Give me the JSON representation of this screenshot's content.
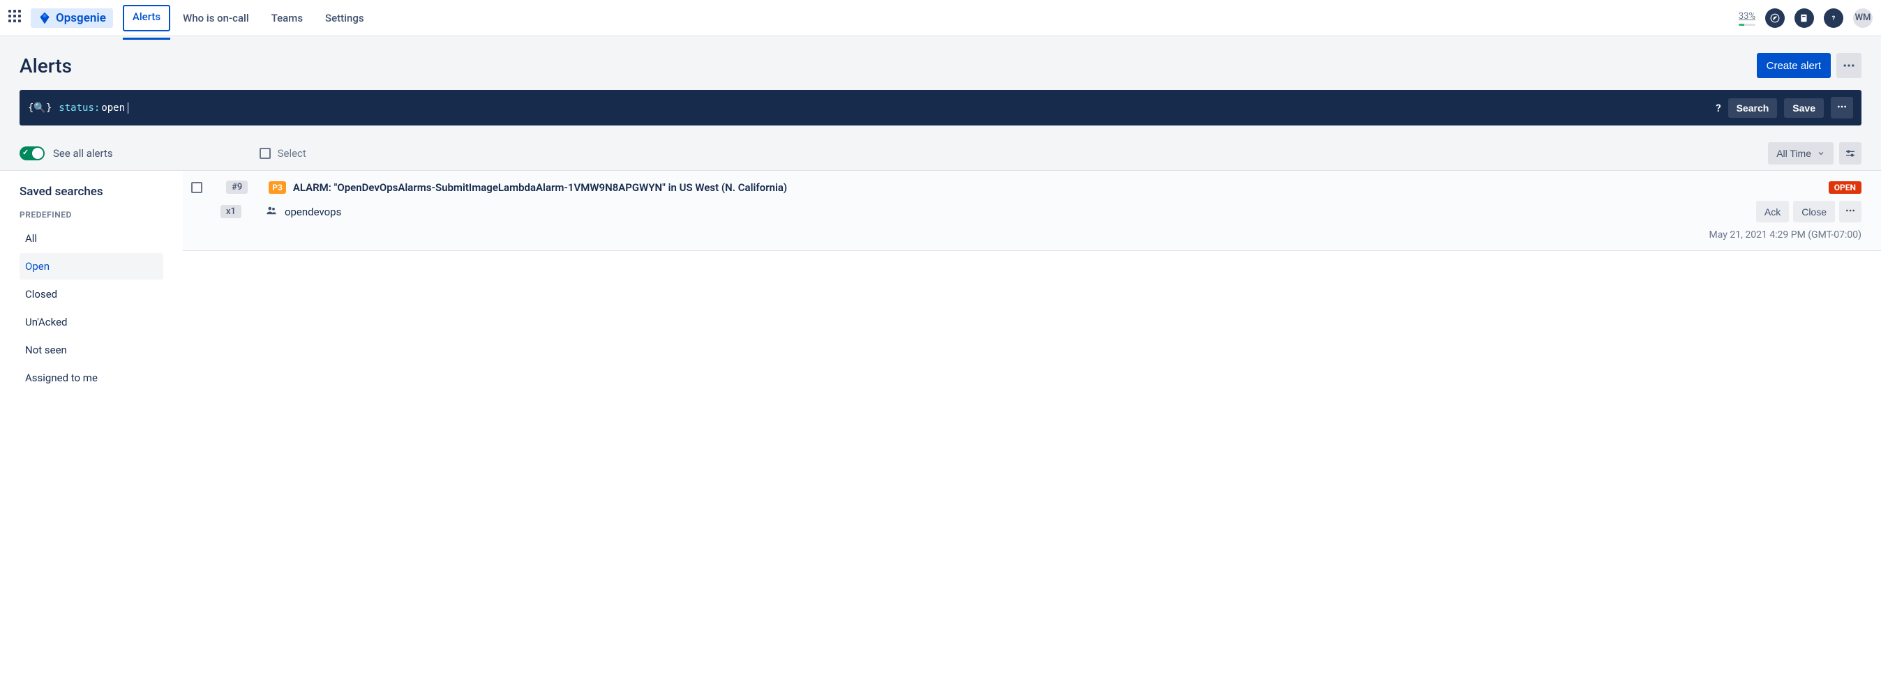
{
  "brand": {
    "name": "Opsgenie"
  },
  "nav": {
    "tabs": [
      "Alerts",
      "Who is on-call",
      "Teams",
      "Settings"
    ],
    "active_index": 0,
    "quota": "33%",
    "avatar": "WM"
  },
  "page": {
    "title": "Alerts",
    "create_button": "Create alert"
  },
  "search": {
    "query_key": "status:",
    "query_val": " open",
    "help": "?",
    "search_btn": "Search",
    "save_btn": "Save"
  },
  "filters": {
    "see_all": "See all alerts",
    "select_label": "Select",
    "time_filter": "All Time"
  },
  "sidebar": {
    "title": "Saved searches",
    "section": "PREDEFINED",
    "items": [
      "All",
      "Open",
      "Closed",
      "Un'Acked",
      "Not seen",
      "Assigned to me"
    ],
    "active_index": 1
  },
  "alerts": [
    {
      "id": "#9",
      "count": "x1",
      "priority": "P3",
      "title": "ALARM: \"OpenDevOpsAlarms-SubmitImageLambdaAlarm-1VMW9N8APGWYN\" in US West (N. California)",
      "status": "OPEN",
      "team": "opendevops",
      "ack_btn": "Ack",
      "close_btn": "Close",
      "timestamp": "May 21, 2021 4:29 PM (GMT-07:00)"
    }
  ]
}
